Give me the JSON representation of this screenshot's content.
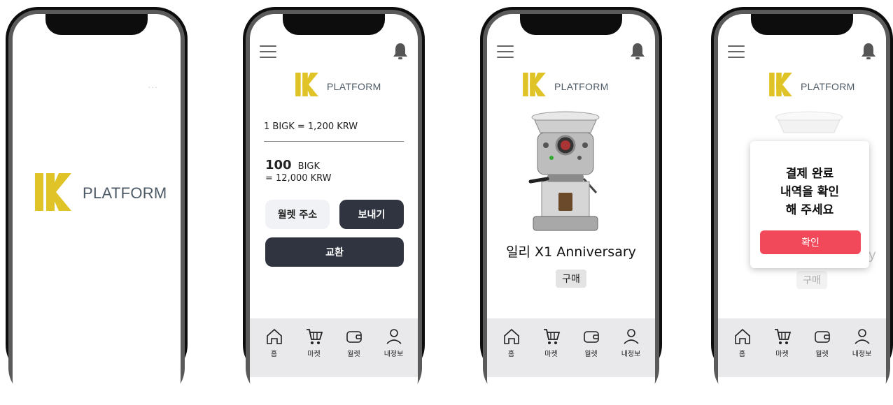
{
  "brand": {
    "word": "PLATFORM",
    "yellow": "#e0c326",
    "slate": "#4d5a66"
  },
  "splash": {
    "more": "..."
  },
  "wallet": {
    "rate": "1 BIGK = 1,200 KRW",
    "balance_amount": "100",
    "balance_unit": "BIGK",
    "balance_krw": "= 12,000 KRW",
    "address_button": "월렛 주소",
    "send_button": "보내기",
    "exchange_button": "교환"
  },
  "market": {
    "product_name": "일리 X1 Anniversary",
    "buy_button": "구매"
  },
  "confirm": {
    "modal_line1": "결제 완료",
    "modal_line2": "내역을 확인",
    "modal_line3": "해 주세요",
    "ok_button": "확인",
    "ok_color": "#f2495a",
    "faded_buy": "구매",
    "faded_suffix": "y"
  },
  "tabs": [
    {
      "label": "홈",
      "icon": "home-icon"
    },
    {
      "label": "마켓",
      "icon": "cart-icon"
    },
    {
      "label": "월렛",
      "icon": "wallet-icon"
    },
    {
      "label": "내정보",
      "icon": "user-icon"
    }
  ]
}
